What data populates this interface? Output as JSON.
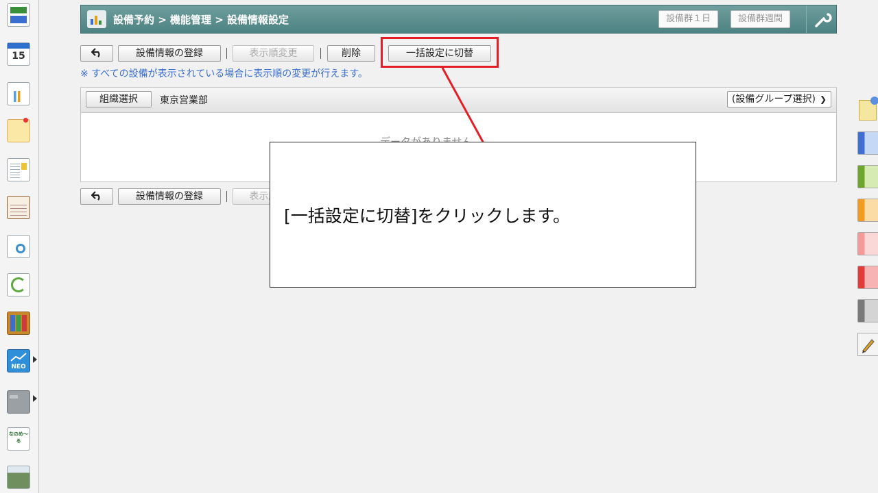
{
  "header": {
    "breadcrumb": "設備予約 > 機能管理 > 設備情報設定",
    "btn_group_day": "設備群１日",
    "btn_group_week": "設備群週間"
  },
  "toolbar": {
    "btn_register": "設備情報の登録",
    "btn_order": "表示順変更",
    "btn_delete": "削除",
    "btn_bulk": "一括設定に切替",
    "note": "※ すべての設備が表示されている場合に表示順の変更が行えます。"
  },
  "panel": {
    "org_button": "組織選択",
    "org_name": "東京営業部",
    "group_select": "(設備グループ選択)",
    "body_text": "データがありません。"
  },
  "toolbar_bottom": {
    "btn_register": "設備情報の登録",
    "btn_order": "表示順変更"
  },
  "callout": {
    "text": "[一括設定に切替]をクリックします。"
  },
  "left_icons": {
    "calendar_day": "15",
    "neo_label": "NEO",
    "mail_label": "なのめ～る"
  },
  "colors": {
    "header": "#4c8382",
    "highlight": "#e31e24",
    "note_text": "#3b6fd0",
    "tabs": [
      "#5b8fe0",
      "#86bb3b",
      "#f5a030",
      "#f8a9a9",
      "#ee4b4b",
      "#8a8a8a"
    ]
  }
}
